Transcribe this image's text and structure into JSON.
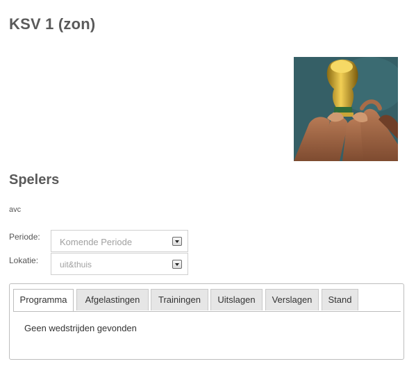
{
  "team": {
    "title": "KSV 1 (zon)"
  },
  "photo": {
    "description": "world-cup-trophy-photo"
  },
  "players": {
    "heading": "Spelers",
    "names": [
      "avc"
    ]
  },
  "filters": {
    "periode": {
      "label": "Periode:",
      "selected": "Komende Periode"
    },
    "lokatie": {
      "label": "Lokatie:",
      "selected": "uit&thuis"
    }
  },
  "tabs": [
    {
      "label": "Programma",
      "active": true
    },
    {
      "label": "Afgelastingen",
      "active": false
    },
    {
      "label": "Trainingen",
      "active": false
    },
    {
      "label": "Uitslagen",
      "active": false
    },
    {
      "label": "Verslagen",
      "active": false
    },
    {
      "label": "Stand",
      "active": false
    }
  ],
  "tab_content": {
    "message": "Geen wedstrijden gevonden"
  }
}
